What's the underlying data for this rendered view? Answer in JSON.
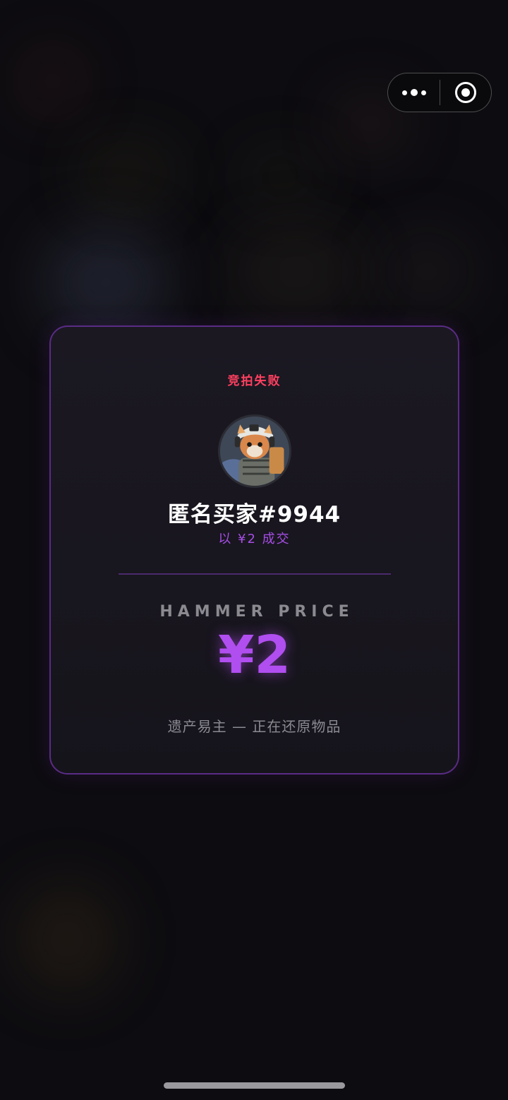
{
  "capsule": {
    "more_icon": "more-dots-icon",
    "close_icon": "target-close-icon"
  },
  "result": {
    "status": "竞拍失败",
    "buyer": "匿名买家#9944",
    "deal_text": "以 ¥2 成交",
    "hammer_label": "HAMMER PRICE",
    "hammer_value": "¥2",
    "note": "遗产易主 — 正在还原物品"
  },
  "colors": {
    "status": "#ff4060",
    "accent": "#b04ef0",
    "card_border": "#5a2b85"
  }
}
